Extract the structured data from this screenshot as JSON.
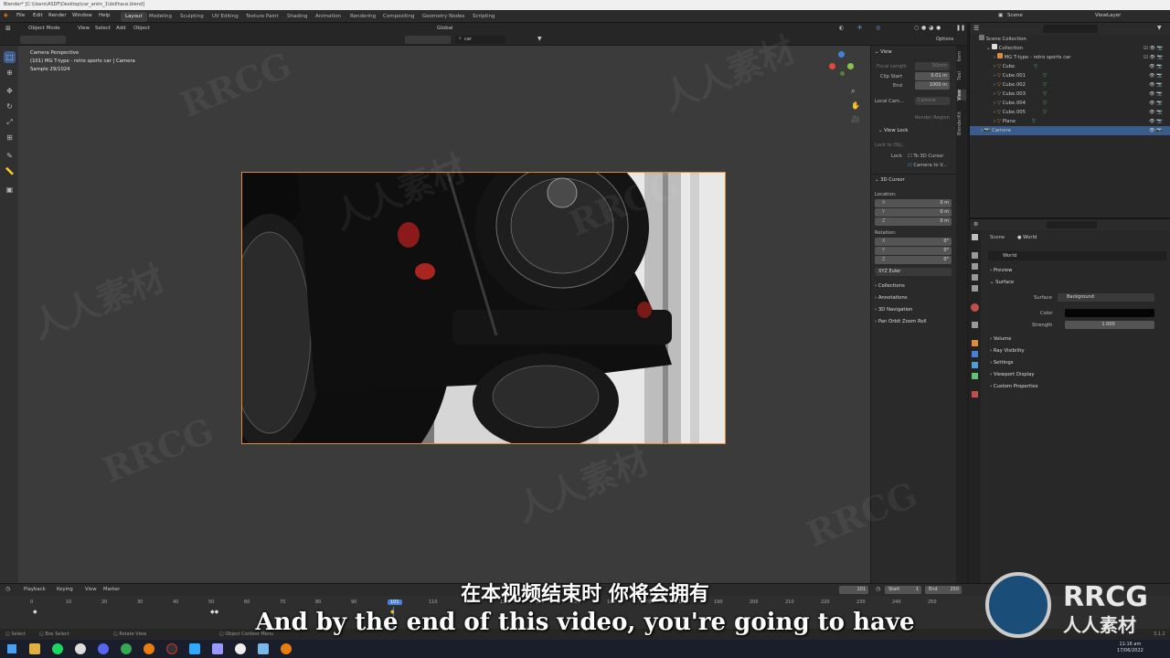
{
  "titlebar": {
    "title": "Blender* [C:\\Users\\ASDF\\Desktop\\car_anim_1\\dollhaus.blend]"
  },
  "menu": [
    "File",
    "Edit",
    "Render",
    "Window",
    "Help"
  ],
  "workspaces": [
    "Layout",
    "Modeling",
    "Sculpting",
    "UV Editing",
    "Texture Paint",
    "Shading",
    "Animation",
    "Rendering",
    "Compositing",
    "Geometry Nodes",
    "Scripting"
  ],
  "topright": {
    "scene": "Scene",
    "viewlayer": "ViewLayer"
  },
  "viewport_header": {
    "mode": "Object Mode",
    "view": "View",
    "select": "Select",
    "add": "Add",
    "object": "Object",
    "orientation": "Global",
    "search": "car",
    "options": "Options"
  },
  "overlay": {
    "line1": "Camera Perspective",
    "line2": "(101) MG T-type - retro sports car | Camera",
    "line3": "Sample 29/1024"
  },
  "npanel": {
    "view_header": "View",
    "focal_label": "Focal Length",
    "focal_value": "50mm",
    "clip_start_label": "Clip Start",
    "clip_start": "0.01 m",
    "end_label": "End",
    "end": "1000 m",
    "local_camera": "Local Cam...",
    "camera_field": "Camera",
    "render_region": "Render Region",
    "view_lock_header": "View Lock",
    "lock_object": "Lock to Obj...",
    "lock_label": "Lock",
    "to_3d_cursor": "To 3D Cursor",
    "camera_to_view": "Camera to V...",
    "cursor_header": "3D Cursor",
    "location_label": "Location:",
    "loc": [
      {
        "axis": "X",
        "value": "0 m"
      },
      {
        "axis": "Y",
        "value": "0 m"
      },
      {
        "axis": "Z",
        "value": "0 m"
      }
    ],
    "rotation_label": "Rotation:",
    "rot": [
      {
        "axis": "X",
        "value": "0°"
      },
      {
        "axis": "Y",
        "value": "0°"
      },
      {
        "axis": "Z",
        "value": "0°"
      }
    ],
    "euler": "XYZ Euler",
    "sections": [
      "Collections",
      "Annotations",
      "3D Navigation",
      "Pan Orbit Zoom Roll"
    ]
  },
  "ntabs": [
    "Item",
    "Tool",
    "View",
    "BlenderKit"
  ],
  "outliner": {
    "search": "",
    "items": [
      {
        "name": "Scene Collection",
        "type": "root"
      },
      {
        "name": "Collection",
        "type": "collection"
      },
      {
        "name": "MG T-type - retro sports car",
        "type": "object"
      },
      {
        "name": "Cube",
        "type": "mesh"
      },
      {
        "name": "Cube.001",
        "type": "mesh"
      },
      {
        "name": "Cube.002",
        "type": "mesh"
      },
      {
        "name": "Cube.003",
        "type": "mesh"
      },
      {
        "name": "Cube.004",
        "type": "mesh"
      },
      {
        "name": "Cube.005",
        "type": "mesh"
      },
      {
        "name": "Plane",
        "type": "mesh"
      },
      {
        "name": "Camera",
        "type": "camera"
      }
    ]
  },
  "properties": {
    "breadcrumb_scene": "Scene",
    "breadcrumb_world": "World",
    "world_name": "World",
    "preview": "Preview",
    "surface_header": "Surface",
    "surface_label": "Surface",
    "surface_value": "Background",
    "color_label": "Color",
    "strength_label": "Strength",
    "strength_value": "1.000",
    "sections": [
      "Volume",
      "Ray Visibility",
      "Settings",
      "Viewport Display",
      "Custom Properties"
    ]
  },
  "timeline": {
    "playback": "Playback",
    "keying": "Keying",
    "view": "View",
    "marker": "Marker",
    "current_frame": "101",
    "start_label": "Start",
    "start": "1",
    "end_label": "End",
    "end": "250",
    "ticks": [
      "0",
      "10",
      "20",
      "30",
      "40",
      "50",
      "60",
      "70",
      "80",
      "90",
      "101",
      "110",
      "120",
      "130",
      "140",
      "150",
      "160",
      "170",
      "180",
      "190",
      "200",
      "210",
      "220",
      "230",
      "240",
      "250"
    ]
  },
  "statusbar": {
    "select": "Select",
    "box_select": "Box Select",
    "rotate_view": "Rotate View",
    "context_menu": "Object Context Menu",
    "version": "3.1.2"
  },
  "taskbar": {
    "time": "11:16 am",
    "date": "17/06/2022"
  },
  "subtitles": {
    "chinese": "在本视频结束时 你将会拥有",
    "english": "And by the end of this video, you're going to have"
  },
  "watermark": {
    "brand": "RRCG",
    "cn": "人人素材"
  },
  "colors": {
    "accent": "#3b5b8a",
    "active_ws": "#3d3d3d",
    "camera_frame": "#e08a3c"
  }
}
